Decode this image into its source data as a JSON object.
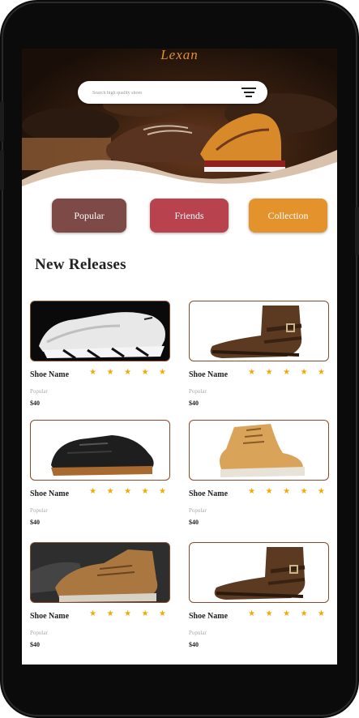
{
  "app": {
    "brand": "Lexan",
    "search": {
      "placeholder": "Search high quality shoes"
    }
  },
  "tabs": [
    {
      "label": "Popular",
      "color": "#7d4a47"
    },
    {
      "label": "Friends",
      "color": "#b9424f"
    },
    {
      "label": "Collection",
      "color": "#e3922c"
    }
  ],
  "section": {
    "title": "New Releases"
  },
  "products": [
    {
      "name": "Shoe Name",
      "category": "Popular",
      "price": "$40",
      "rating": "★ ★ ★ ★ ★",
      "image": "white-sneaker"
    },
    {
      "name": "Shoe Name",
      "category": "Popular",
      "price": "$40",
      "rating": "★ ★ ★ ★ ★",
      "image": "brown-buckle-boot"
    },
    {
      "name": "Shoe Name",
      "category": "Popular",
      "price": "$40",
      "rating": "★ ★ ★ ★ ★",
      "image": "black-gum-sneaker"
    },
    {
      "name": "Shoe Name",
      "category": "Popular",
      "price": "$40",
      "rating": "★ ★ ★ ★ ★",
      "image": "tan-work-boot"
    },
    {
      "name": "Shoe Name",
      "category": "Popular",
      "price": "$40",
      "rating": "★ ★ ★ ★ ★",
      "image": "tan-hiking-boots"
    },
    {
      "name": "Shoe Name",
      "category": "Popular",
      "price": "$40",
      "rating": "★ ★ ★ ★ ★",
      "image": "brown-buckle-boot"
    }
  ],
  "colors": {
    "accent": "#e0902f",
    "star": "#f2a900",
    "card_border": "#8a4a2a"
  }
}
